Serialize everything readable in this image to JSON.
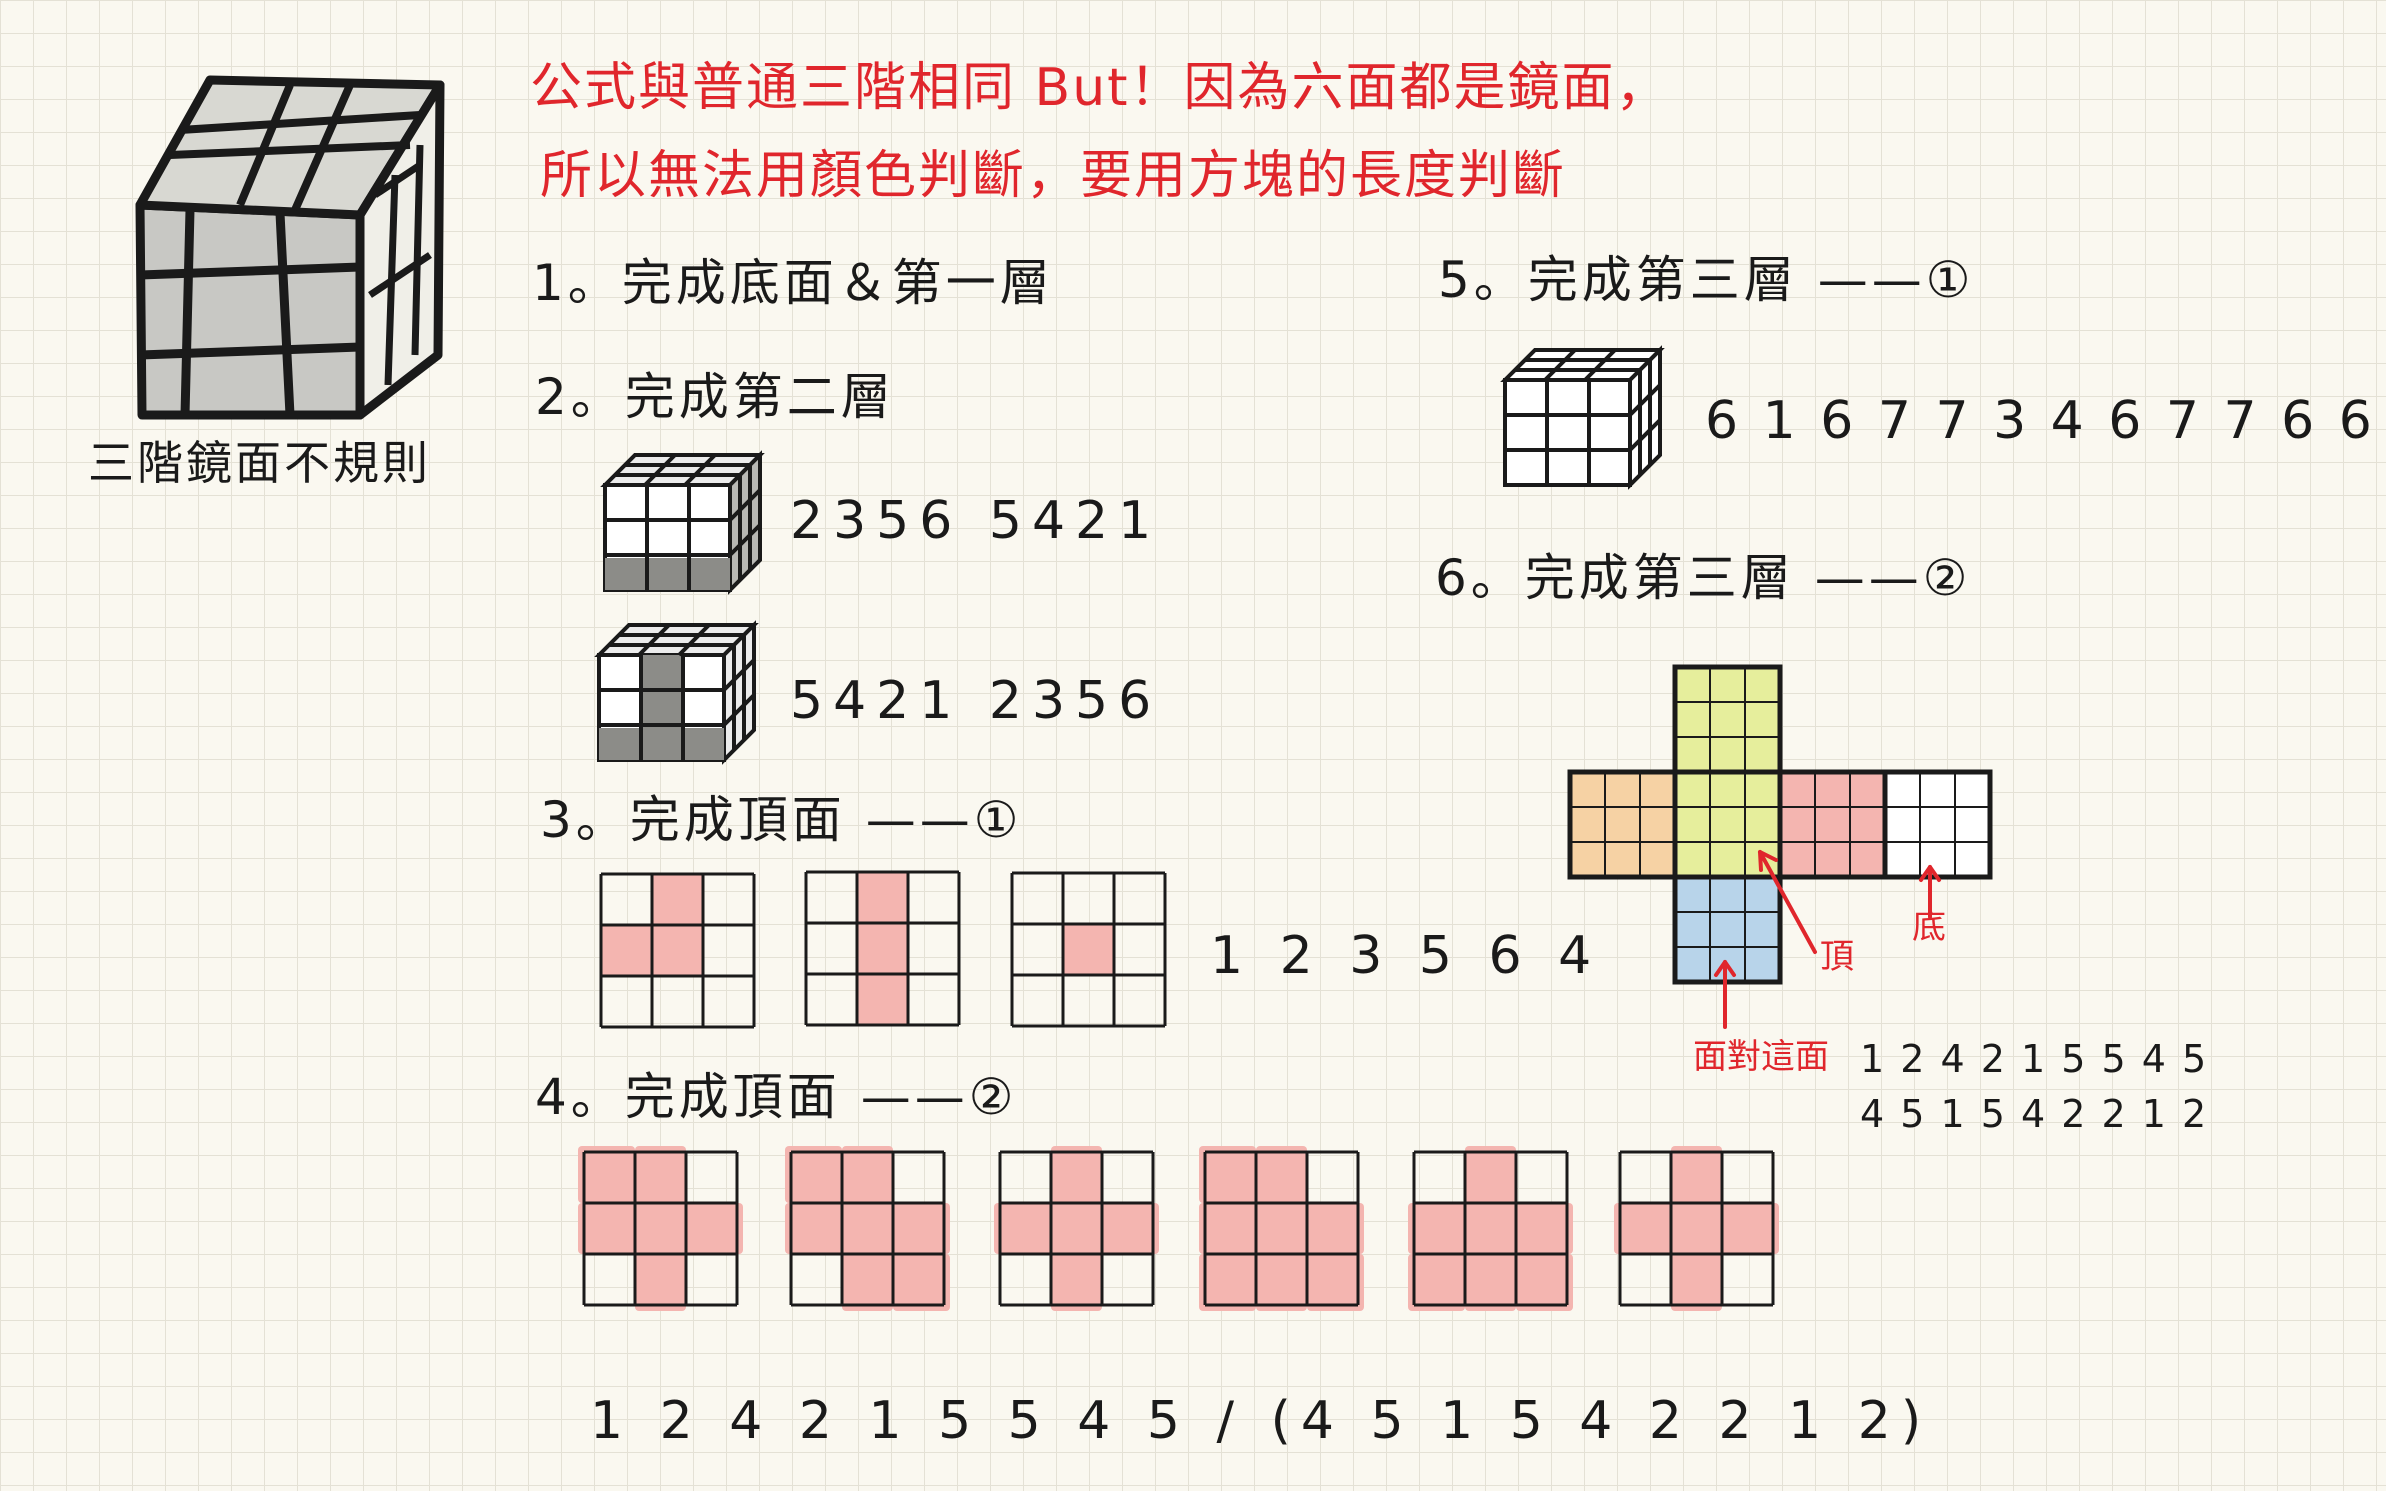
{
  "heading": {
    "line1": "公式與普通三階相同 But！因為六面都是鏡面，",
    "line2": "所以無法用顏色判斷，要用方塊的長度判斷"
  },
  "cube_caption": "三階鏡面不規則",
  "steps": {
    "s1": "1。完成底面＆第一層",
    "s2": "2。完成第二層",
    "s3": "3。完成頂面 ——①",
    "s4": "4。完成頂面 ——②",
    "s5": "5。完成第三層 ——①",
    "s6": "6。完成第三層 ——②"
  },
  "algorithms": {
    "s2_a": "2356  5421",
    "s2_b": "5421  2356",
    "s3": "1 2 3 5 6 4",
    "s4": "1 2 4 2 1 5 5 4 5 / (4 5 1 5 4 2 2 1 2)",
    "s5": "6 1 6 7 7 3 4 6 7 7 6 6",
    "s6_line1": "1 2 4 2 1 5 5 4 5",
    "s6_line2": "4 5 1 5 4 2 2 1 2"
  },
  "net_labels": {
    "top": "頂",
    "bottom": "底",
    "facing": "面對這面"
  },
  "colors": {
    "ink": "#1a1a1a",
    "red": "#e0262c",
    "pink": "#f4b5b0",
    "yellow": "#e6ee9c",
    "orange": "#f6d2a4",
    "blue": "#b8d4ea",
    "gray": "#c8c8c4"
  },
  "patterns": {
    "step3": [
      [
        [
          0,
          1,
          0
        ],
        [
          1,
          1,
          0
        ],
        [
          0,
          0,
          0
        ]
      ],
      [
        [
          0,
          1,
          0
        ],
        [
          0,
          1,
          0
        ],
        [
          0,
          1,
          0
        ]
      ],
      [
        [
          0,
          0,
          0
        ],
        [
          0,
          1,
          0
        ],
        [
          0,
          0,
          0
        ]
      ]
    ],
    "step4": [
      [
        [
          1,
          1,
          0
        ],
        [
          1,
          1,
          1
        ],
        [
          0,
          1,
          0
        ]
      ],
      [
        [
          1,
          1,
          0
        ],
        [
          1,
          1,
          1
        ],
        [
          0,
          1,
          1
        ]
      ],
      [
        [
          0,
          1,
          0
        ],
        [
          1,
          1,
          1
        ],
        [
          0,
          1,
          0
        ]
      ],
      [
        [
          1,
          1,
          0
        ],
        [
          1,
          1,
          1
        ],
        [
          1,
          1,
          1
        ]
      ],
      [
        [
          0,
          1,
          0
        ],
        [
          1,
          1,
          1
        ],
        [
          1,
          1,
          1
        ]
      ],
      [
        [
          0,
          1,
          0
        ],
        [
          1,
          1,
          1
        ],
        [
          0,
          1,
          0
        ]
      ]
    ]
  }
}
